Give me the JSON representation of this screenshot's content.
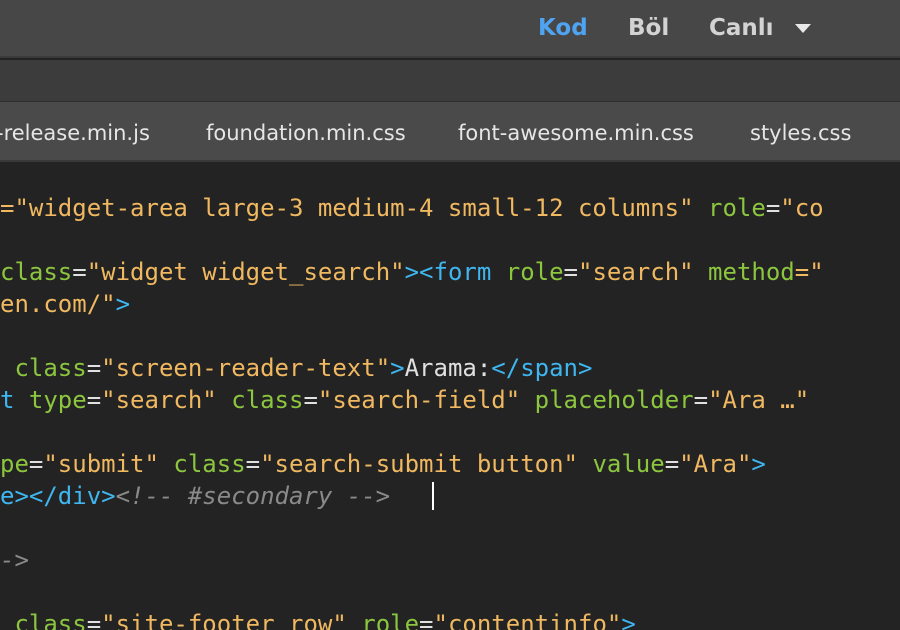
{
  "view_switcher": {
    "code_label": "Kod",
    "split_label": "Böl",
    "live_label": "Canlı",
    "active_color": "#4fa3f0"
  },
  "file_tabs": [
    {
      "label": "-release.min.js"
    },
    {
      "label": "foundation.min.css"
    },
    {
      "label": "font-awesome.min.css"
    },
    {
      "label": "styles.css"
    }
  ],
  "code_lines": [
    [
      {
        "t": "=\"widget-area large-3 medium-4 small-12 columns\"",
        "c": "str"
      },
      {
        "t": " ",
        "c": "plain"
      },
      {
        "t": "role",
        "c": "attr"
      },
      {
        "t": "=",
        "c": "eq"
      },
      {
        "t": "\"co",
        "c": "str"
      }
    ],
    [],
    [
      {
        "t": "class",
        "c": "attr"
      },
      {
        "t": "=",
        "c": "eq"
      },
      {
        "t": "\"widget widget_search\"",
        "c": "str"
      },
      {
        "t": "><form",
        "c": "tag"
      },
      {
        "t": " ",
        "c": "plain"
      },
      {
        "t": "role",
        "c": "attr"
      },
      {
        "t": "=",
        "c": "eq"
      },
      {
        "t": "\"search\"",
        "c": "str"
      },
      {
        "t": " ",
        "c": "plain"
      },
      {
        "t": "method",
        "c": "attr"
      },
      {
        "t": "=\"",
        "c": "str"
      }
    ],
    [
      {
        "t": "en.com/\"",
        "c": "str"
      },
      {
        "t": ">",
        "c": "tag"
      }
    ],
    [],
    [
      {
        "t": " ",
        "c": "plain"
      },
      {
        "t": "class",
        "c": "attr"
      },
      {
        "t": "=",
        "c": "eq"
      },
      {
        "t": "\"screen-reader-text\"",
        "c": "str"
      },
      {
        "t": ">",
        "c": "tag"
      },
      {
        "t": "Arama:",
        "c": "plain"
      },
      {
        "t": "</span>",
        "c": "tag"
      }
    ],
    [
      {
        "t": "t",
        "c": "tag"
      },
      {
        "t": " ",
        "c": "plain"
      },
      {
        "t": "type",
        "c": "attr"
      },
      {
        "t": "=",
        "c": "eq"
      },
      {
        "t": "\"search\"",
        "c": "str"
      },
      {
        "t": " ",
        "c": "plain"
      },
      {
        "t": "class",
        "c": "attr"
      },
      {
        "t": "=",
        "c": "eq"
      },
      {
        "t": "\"search-field\"",
        "c": "str"
      },
      {
        "t": " ",
        "c": "plain"
      },
      {
        "t": "placeholder",
        "c": "attr"
      },
      {
        "t": "=",
        "c": "eq"
      },
      {
        "t": "\"Ara …\"",
        "c": "str"
      }
    ],
    [],
    [
      {
        "t": "pe",
        "c": "attr"
      },
      {
        "t": "=",
        "c": "eq"
      },
      {
        "t": "\"submit\"",
        "c": "str"
      },
      {
        "t": " ",
        "c": "plain"
      },
      {
        "t": "class",
        "c": "attr"
      },
      {
        "t": "=",
        "c": "eq"
      },
      {
        "t": "\"search-submit button\"",
        "c": "str"
      },
      {
        "t": " ",
        "c": "plain"
      },
      {
        "t": "value",
        "c": "attr"
      },
      {
        "t": "=",
        "c": "eq"
      },
      {
        "t": "\"Ara\"",
        "c": "str"
      },
      {
        "t": ">",
        "c": "tag"
      }
    ],
    [
      {
        "t": "e></div>",
        "c": "tag"
      },
      {
        "t": "<!-- #secondary -->",
        "c": "comment"
      }
    ],
    [],
    [
      {
        "t": "->",
        "c": "comment"
      }
    ],
    [],
    [
      {
        "t": " ",
        "c": "plain"
      },
      {
        "t": "class",
        "c": "attr"
      },
      {
        "t": "=",
        "c": "eq"
      },
      {
        "t": "\"site-footer row\"",
        "c": "str"
      },
      {
        "t": " ",
        "c": "plain"
      },
      {
        "t": "role",
        "c": "attr"
      },
      {
        "t": "=",
        "c": "eq"
      },
      {
        "t": "\"contentinfo\"",
        "c": "str"
      },
      {
        "t": ">",
        "c": "tag"
      }
    ]
  ]
}
